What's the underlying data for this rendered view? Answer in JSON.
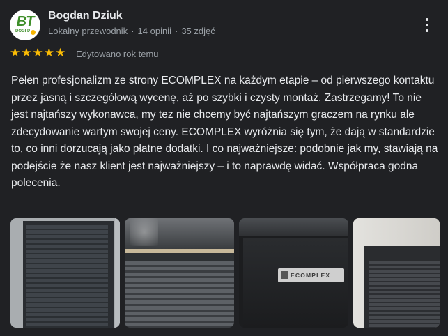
{
  "reviewer": {
    "name": "Bogdan Dziuk",
    "avatar_monogram": "BT",
    "avatar_subtext": "DOGI D",
    "level": "Lokalny przewodnik",
    "reviews": "14 opinii",
    "photos": "35 zdjęć",
    "separator": "·"
  },
  "rating": {
    "stars": 5,
    "star_glyphs": [
      "★",
      "★",
      "★",
      "★",
      "★"
    ],
    "star_color": "#fbbc04",
    "edited": "Edytowano rok temu"
  },
  "review": {
    "text": "Pełen profesjonalizm ze strony ECOMPLEX na każdym etapie – od pierwszego kontaktu przez jasną i szczegółową wycenę, aż po szybki i czysty montaż. Zastrzegamy! To nie jest najtańszy wykonawca, my tez nie chcemy być najtańszym graczem na rynku ale zdecydowanie wartym swojej ceny. ECOMPLEX wyróżnia się tym, że dają w standardzie to, co inni dorzucają jako płatne dodatki. I co najważniejsze: podobnie jak my, stawiają na podejście że nasz klient jest najważniejszy – i to naprawdę widać. Współpraca godna polecenia."
  },
  "photos": {
    "badge_text": "ECOMPLEX"
  },
  "icons": {
    "more": "more-vert-icon",
    "star": "star-icon"
  }
}
